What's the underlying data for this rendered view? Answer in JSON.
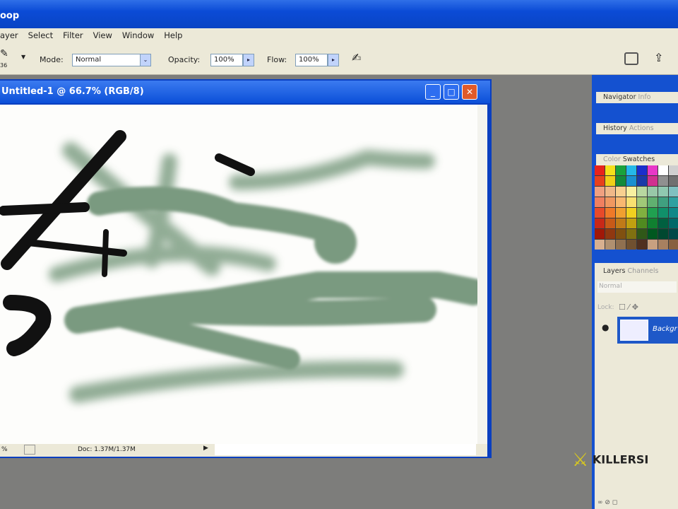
{
  "app_title": "oop",
  "menu": [
    "ayer",
    "Select",
    "Filter",
    "View",
    "Window",
    "Help"
  ],
  "options": {
    "brush_size": "36",
    "mode_label": "Mode:",
    "mode_value": "Normal",
    "opacity_label": "Opacity:",
    "opacity_value": "100%",
    "flow_label": "Flow:",
    "flow_value": "100%"
  },
  "document": {
    "title": "Untitled-1 @ 66.7% (RGB/8)",
    "zoom": "%",
    "doc_info": "Doc: 1.37M/1.37M"
  },
  "panels": {
    "navigator": "Navigator",
    "info": "Info",
    "history": "History",
    "actions": "Actions",
    "color": "Color",
    "swatches": "Swatches",
    "layers": "Layers",
    "channels": "Channels",
    "blend_mode": "Normal",
    "lock_label": "Lock:",
    "layer_name": "Backgr"
  },
  "swatch_colors": [
    "#e8231c",
    "#f5e01a",
    "#1aa23c",
    "#25b8e8",
    "#1a2fcc",
    "#e838c8",
    "#ffffff",
    "#cfcfcf",
    "#e8401c",
    "#f0d018",
    "#148a3a",
    "#1a90d0",
    "#1a3aa8",
    "#d03090",
    "#909090",
    "#707070",
    "#f0a080",
    "#f0b888",
    "#f8d090",
    "#f8f0a0",
    "#b8d8a0",
    "#98c8a8",
    "#90c8b0",
    "#80c0c0",
    "#f08060",
    "#f09860",
    "#f8b870",
    "#f8e070",
    "#a0c878",
    "#60b070",
    "#40a080",
    "#30a0a0",
    "#e84a2a",
    "#f07a28",
    "#f0a030",
    "#f0d020",
    "#80b040",
    "#20a050",
    "#10906a",
    "#108888",
    "#c82818",
    "#c85a18",
    "#c07a18",
    "#c0a010",
    "#508a20",
    "#108030",
    "#006040",
    "#006868",
    "#a01808",
    "#903810",
    "#805010",
    "#807010",
    "#305818",
    "#005820",
    "#004830",
    "#004848",
    "#d8b090",
    "#b09070",
    "#907050",
    "#705030",
    "#503020",
    "#c8a080",
    "#a88060",
    "#886040"
  ],
  "logo_text": "KILLERSI"
}
